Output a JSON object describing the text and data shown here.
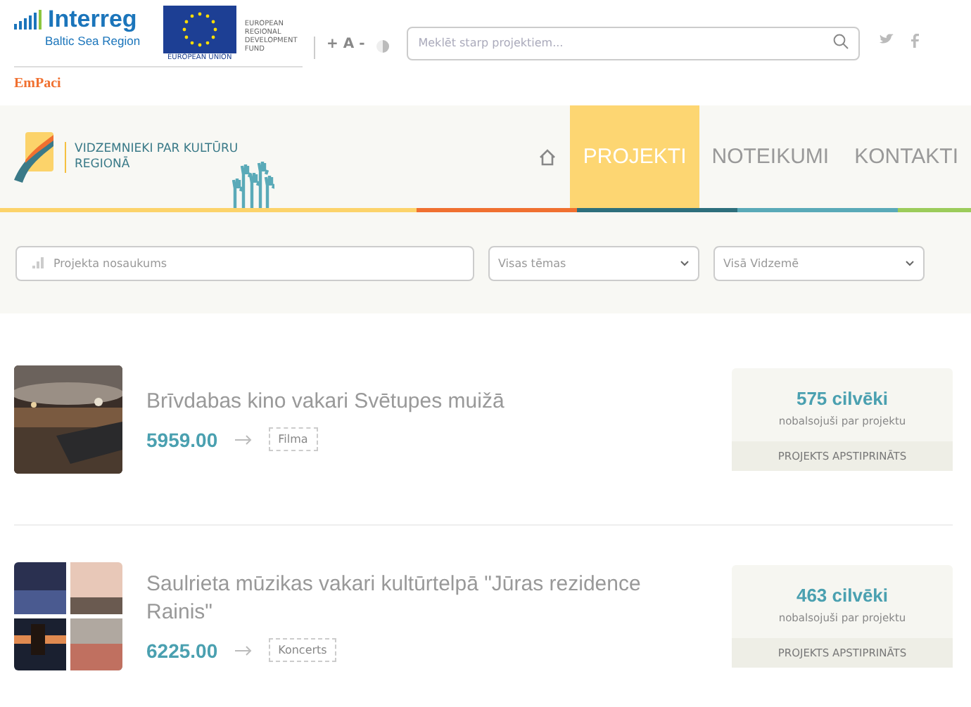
{
  "header": {
    "interreg": "Interreg",
    "region": "Baltic Sea Region",
    "eu_label": "EUROPEAN UNION",
    "fund": "EUROPEAN REGIONAL DEVELOPMENT FUND",
    "project": "EmPaci",
    "font_size": "+ A -",
    "search": {
      "placeholder": "Meklēt starp projektiem..."
    }
  },
  "site": {
    "title": "VIDZEMNIEKI PAR KULTŪRU REGIONĀ"
  },
  "nav": [
    {
      "kind": "home",
      "selected": false
    },
    {
      "kind": "text",
      "label": "PROJEKTI",
      "selected": true
    },
    {
      "kind": "text",
      "label": "NOTEIKUMI",
      "selected": false
    },
    {
      "kind": "text",
      "label": "KONTAKTI",
      "selected": false
    }
  ],
  "filters": {
    "name": {
      "placeholder": "Projekta nosaukums"
    },
    "theme": "Visas tēmas",
    "region": "Visā Vidzemē"
  },
  "projects": [
    {
      "title": "Brīvdabas kino vakari Svētupes muižā",
      "amount": "5959.00",
      "category": "Filma",
      "votes": "575 cilvēki",
      "votes_note": "nobalsojuši par projektu",
      "status": "PROJEKTS APSTIPRINĀTS",
      "kind": "picture"
    },
    {
      "title": "Saulrieta mūzikas vakari kultūrtelpā \"Jūras rezidence Rainis\"",
      "amount": "6225.00",
      "category": "Koncerts",
      "votes": "463 cilvēki",
      "votes_note": "nobalsojuši par projektu",
      "status": "PROJEKTS APSTIPRINĀTS",
      "kind": "picture"
    }
  ]
}
